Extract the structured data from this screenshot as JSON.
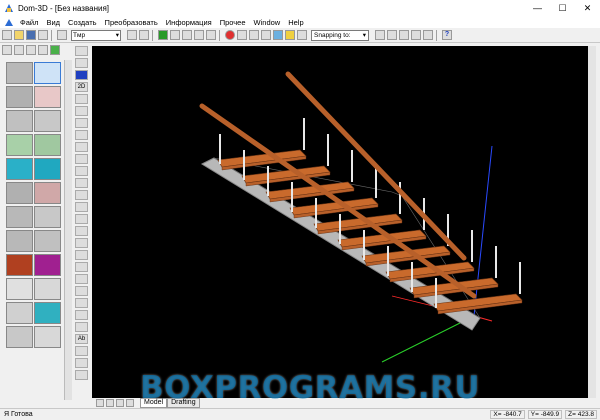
{
  "window": {
    "title": "Dom-3D - [Без названия]",
    "minimize": "—",
    "maximize": "☐",
    "close": "✕"
  },
  "menu": {
    "items": [
      "Файл",
      "Вид",
      "Создать",
      "Преобразовать",
      "Информация",
      "Прочее",
      "Window",
      "Help"
    ]
  },
  "toolbar": {
    "layer_value": "Tмр",
    "snap_label": "Snapping to:",
    "help_label": "?"
  },
  "tool_column": {
    "labels": [
      "2D",
      "Ab"
    ]
  },
  "bottom_tabs": [
    "Model",
    "Drafting"
  ],
  "status": {
    "text": "Я Готова",
    "x": "X= -840.7",
    "y": "Y= -849.9",
    "z": "Z= 423.8"
  },
  "watermark": "BOXPROGRAMS.RU",
  "colors": {
    "viewport_bg": "#000000",
    "tread": "#b8602a",
    "tread_top": "#c96a2c",
    "stringer": "#b8b8b8",
    "baluster": "#e8e8e8",
    "axis_x": "#ff2a2a",
    "axis_y": "#2ad02a",
    "axis_z": "#2a4aff"
  }
}
